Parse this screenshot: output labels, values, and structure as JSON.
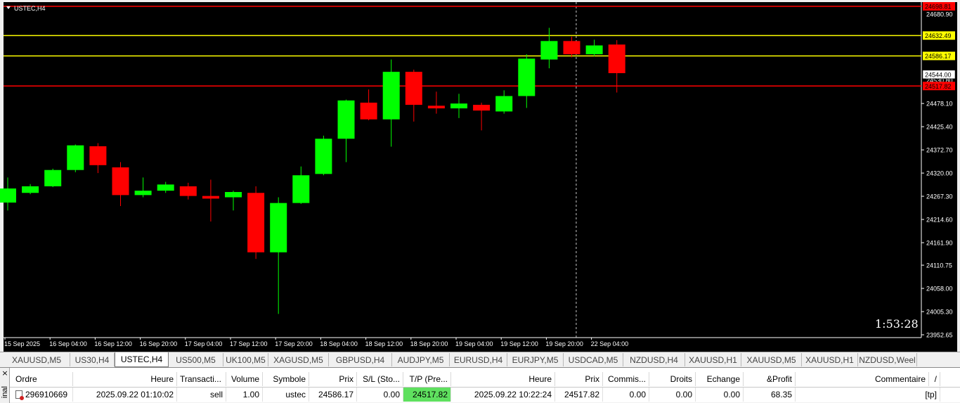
{
  "chart": {
    "symbol_label": "USTEC,H4",
    "timer": "1:53:28",
    "background": "#000000",
    "bull_color": "#00ff00",
    "bear_color": "#ff0000",
    "axis_text_color": "#ffffff"
  },
  "chart_data": {
    "type": "candlestick",
    "ylim": [
      23952.65,
      24698.81
    ],
    "yticks": [
      "24005.30",
      "24058.00",
      "24110.75",
      "24161.90",
      "24214.60",
      "24267.30",
      "24320.00",
      "24372.70",
      "24425.40",
      "24478.10",
      "24530.80",
      "24586.17",
      "24632.49",
      "23952.65",
      "24005.30"
    ],
    "yticks_values": [
      24005.3,
      24058.0,
      24110.75,
      24161.9,
      24214.6,
      24267.3,
      24320.0,
      24372.7,
      24425.4,
      24478.1
    ],
    "yticks_display": [
      "24005.30",
      "24058.00",
      "24110.75",
      "24161.90",
      "24214.60",
      "24267.30",
      "24320.00",
      "24372.70",
      "24425.40",
      "24478.10",
      "23952.65"
    ],
    "yticks_display_values": [
      24005.3,
      24058.0,
      24110.75,
      24161.9,
      24214.6,
      24267.3,
      24320.0,
      24372.7,
      24425.4,
      24478.1,
      23952.65
    ],
    "top_partial_tick": "24680.90",
    "xlabels": [
      "15 Sep 2025",
      "16 Sep 04:00",
      "16 Sep 12:00",
      "16 Sep 20:00",
      "17 Sep 04:00",
      "17 Sep 12:00",
      "17 Sep 20:00",
      "18 Sep 04:00",
      "18 Sep 12:00",
      "18 Sep 20:00",
      "19 Sep 04:00",
      "19 Sep 12:00",
      "19 Sep 20:00",
      "22 Sep 04:00"
    ],
    "candles": [
      {
        "o": 24253,
        "h": 24310,
        "l": 24235,
        "c": 24285
      },
      {
        "o": 24275,
        "h": 24295,
        "l": 24272,
        "c": 24290
      },
      {
        "o": 24290,
        "h": 24330,
        "l": 24288,
        "c": 24327
      },
      {
        "o": 24327,
        "h": 24385,
        "l": 24322,
        "c": 24383
      },
      {
        "o": 24381,
        "h": 24388,
        "l": 24320,
        "c": 24338
      },
      {
        "o": 24333,
        "h": 24345,
        "l": 24245,
        "c": 24270
      },
      {
        "o": 24270,
        "h": 24310,
        "l": 24265,
        "c": 24280
      },
      {
        "o": 24280,
        "h": 24300,
        "l": 24275,
        "c": 24294
      },
      {
        "o": 24290,
        "h": 24298,
        "l": 24260,
        "c": 24268
      },
      {
        "o": 24268,
        "h": 24305,
        "l": 24210,
        "c": 24262
      },
      {
        "o": 24265,
        "h": 24280,
        "l": 24235,
        "c": 24277
      },
      {
        "o": 24275,
        "h": 24290,
        "l": 24125,
        "c": 24140
      },
      {
        "o": 24140,
        "h": 24265,
        "l": 24000,
        "c": 24252
      },
      {
        "o": 24252,
        "h": 24335,
        "l": 24250,
        "c": 24315
      },
      {
        "o": 24318,
        "h": 24405,
        "l": 24315,
        "c": 24398
      },
      {
        "o": 24398,
        "h": 24487,
        "l": 24345,
        "c": 24485
      },
      {
        "o": 24480,
        "h": 24510,
        "l": 24440,
        "c": 24442
      },
      {
        "o": 24442,
        "h": 24578,
        "l": 24380,
        "c": 24550
      },
      {
        "o": 24550,
        "h": 24555,
        "l": 24437,
        "c": 24475
      },
      {
        "o": 24473,
        "h": 24505,
        "l": 24455,
        "c": 24467
      },
      {
        "o": 24467,
        "h": 24500,
        "l": 24445,
        "c": 24478
      },
      {
        "o": 24475,
        "h": 24480,
        "l": 24417,
        "c": 24462
      },
      {
        "o": 24460,
        "h": 24508,
        "l": 24455,
        "c": 24495
      },
      {
        "o": 24495,
        "h": 24590,
        "l": 24468,
        "c": 24580
      },
      {
        "o": 24578,
        "h": 24650,
        "l": 24558,
        "c": 24620
      },
      {
        "o": 24620,
        "h": 24630,
        "l": 24583,
        "c": 24590
      },
      {
        "o": 24590,
        "h": 24623,
        "l": 24585,
        "c": 24610
      },
      {
        "o": 24612,
        "h": 24622,
        "l": 24503,
        "c": 24547
      }
    ],
    "hlines": [
      {
        "price": 24698.81,
        "label": "24698.81",
        "color": "#ff0000"
      },
      {
        "price": 24632.49,
        "label": "24632.49",
        "color": "#ffff00"
      },
      {
        "price": 24586.17,
        "label": "24586.17",
        "color": "#ffff00"
      },
      {
        "price": 24517.82,
        "label": "24517.82",
        "color": "#ff0000"
      }
    ],
    "current_price_label": "24544.00",
    "crosshair_x_index": 25.2
  },
  "tabs": [
    "XAUUSD,M5",
    "US30,H4",
    "USTEC,H4",
    "US500,M5",
    "UK100,M5",
    "XAGUSD,M5",
    "GBPUSD,H4",
    "AUDJPY,M5",
    "EURUSD,H4",
    "EURJPY,M5",
    "USDCAD,M5",
    "NZDUSD,H4",
    "XAUUSD,H1",
    "XAUUSD,M5",
    "XAUUSD,H1",
    "NZDUSD,Weel"
  ],
  "active_tab": 2,
  "terminal": {
    "label": "inal",
    "close": "×",
    "headers": [
      "Ordre",
      "Heure",
      "Transacti...",
      "Volume",
      "Symbole",
      "Prix",
      "S/L (Sto...",
      "T/P (Pre...",
      "Heure",
      "Prix",
      "Commis...",
      "Droits",
      "Echange",
      "&Profit",
      "Commentaire",
      "/"
    ],
    "row": [
      "296910669",
      "2025.09.22 01:10:02",
      "sell",
      "1.00",
      "ustec",
      "24586.17",
      "0.00",
      "24517.82",
      "2025.09.22 10:22:24",
      "24517.82",
      "0.00",
      "0.00",
      "0.00",
      "68.35",
      "[tp]"
    ]
  }
}
